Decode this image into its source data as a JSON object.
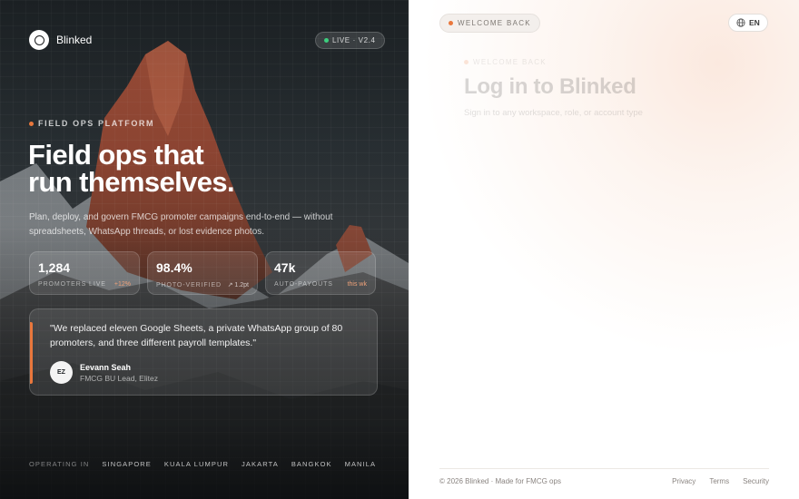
{
  "brand": {
    "name": "Blinked",
    "live_badge": "LIVE · V2.4"
  },
  "hero": {
    "eyebrow": "FIELD OPS PLATFORM",
    "headline_line1": "Field ops that",
    "headline_line2": "run themselves.",
    "subcopy": "Plan, deploy, and govern FMCG promoter campaigns end-to-end — without spreadsheets, WhatsApp threads, or lost evidence photos.",
    "stats": [
      {
        "value": "1,284",
        "label": "PROMOTERS LIVE",
        "delta": "+12%"
      },
      {
        "value": "98.4%",
        "label": "PHOTO-VERIFIED",
        "delta": "↗ 1.2pt"
      },
      {
        "value": "47k",
        "label": "AUTO-PAYOUTS",
        "delta": "this wk"
      }
    ],
    "quote": {
      "text": "\"We replaced eleven Google Sheets, a private WhatsApp group of 80 promoters, and three different payroll templates.\"",
      "initials": "EZ",
      "author": "Eevann Seah",
      "role": "FMCG BU Lead, Elitez"
    },
    "operating": {
      "label": "OPERATING IN",
      "cities": [
        "SINGAPORE",
        "KUALA LUMPUR",
        "JAKARTA",
        "BANGKOK",
        "MANILA"
      ]
    }
  },
  "right": {
    "welcome_pill": "WELCOME BACK",
    "language": "EN",
    "form_eyebrow": "WELCOME BACK",
    "form_title": "Log in to Blinked",
    "form_subtitle": "Sign in to any workspace, role, or account type",
    "footer": {
      "copyright": "© 2026 Blinked · Made for FMCG ops",
      "links": [
        "Privacy",
        "Terms",
        "Security"
      ]
    }
  },
  "colors": {
    "accent": "#e9773c",
    "live": "#3ccf7e",
    "hero_dark": "#1f2528"
  }
}
